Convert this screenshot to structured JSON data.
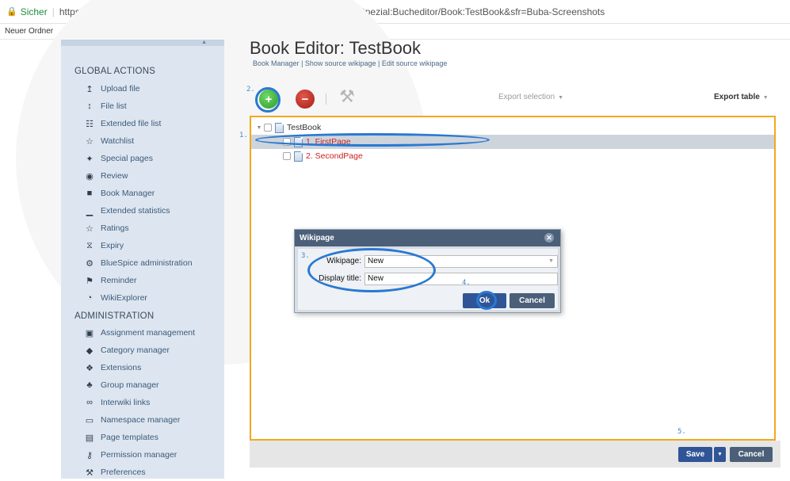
{
  "browser": {
    "secure_label": "Sicher",
    "url": "https://evaluation-de.bluespice.com/Buba-Screenshots/index.php?title=Spezial:Bucheditor/Book:TestBook&sfr=Buba-Screenshots",
    "bookmark": "Neuer Ordner"
  },
  "sidebar": {
    "global_heading": "GLOBAL ACTIONS",
    "global_items": [
      {
        "label": "Upload file",
        "icon": "upload-icon"
      },
      {
        "label": "File list",
        "icon": "sort-icon"
      },
      {
        "label": "Extended file list",
        "icon": "list-box-icon"
      },
      {
        "label": "Watchlist",
        "icon": "star-icon"
      },
      {
        "label": "Special pages",
        "icon": "special-icon"
      },
      {
        "label": "Review",
        "icon": "eye-icon"
      },
      {
        "label": "Book Manager",
        "icon": "book-icon"
      },
      {
        "label": "Extended statistics",
        "icon": "chart-icon"
      },
      {
        "label": "Ratings",
        "icon": "star-outline-icon"
      },
      {
        "label": "Expiry",
        "icon": "hourglass-icon"
      },
      {
        "label": "BlueSpice administration",
        "icon": "gear-icon"
      },
      {
        "label": "Reminder",
        "icon": "flag-icon"
      },
      {
        "label": "WikiExplorer",
        "icon": "compass-icon"
      }
    ],
    "admin_heading": "ADMINISTRATION",
    "admin_items": [
      {
        "label": "Assignment management",
        "icon": "assignment-icon"
      },
      {
        "label": "Category manager",
        "icon": "tag-icon"
      },
      {
        "label": "Extensions",
        "icon": "puzzle-icon"
      },
      {
        "label": "Group manager",
        "icon": "group-icon"
      },
      {
        "label": "Interwiki links",
        "icon": "link-icon"
      },
      {
        "label": "Namespace manager",
        "icon": "namespace-icon"
      },
      {
        "label": "Page templates",
        "icon": "template-icon"
      },
      {
        "label": "Permission manager",
        "icon": "key-icon"
      },
      {
        "label": "Preferences",
        "icon": "wrench-icon"
      }
    ]
  },
  "main": {
    "title": "Book Editor: TestBook",
    "subnav": [
      "Book Manager",
      "Show source wikipage",
      "Edit source wikipage"
    ],
    "subnav_sep": "|",
    "export_selection": "Export selection",
    "export_table": "Export table",
    "tree": {
      "root": "TestBook",
      "children": [
        "1. FirstPage",
        "2. SecondPage"
      ]
    },
    "save_label": "Save",
    "cancel_label": "Cancel"
  },
  "dialog": {
    "title": "Wikipage",
    "wikipage_label": "Wikipage:",
    "wikipage_value": "New",
    "display_title_label": "Display title:",
    "display_title_value": "New",
    "ok_label": "Ok",
    "cancel_label": "Cancel"
  },
  "annotations": [
    "1.",
    "2.",
    "3.",
    "4.",
    "5."
  ],
  "colors": {
    "highlight_border": "#f2a81d",
    "annotation_blue": "#2979d2",
    "primary_button": "#2f5596",
    "secondary_button": "#4b5f78"
  }
}
